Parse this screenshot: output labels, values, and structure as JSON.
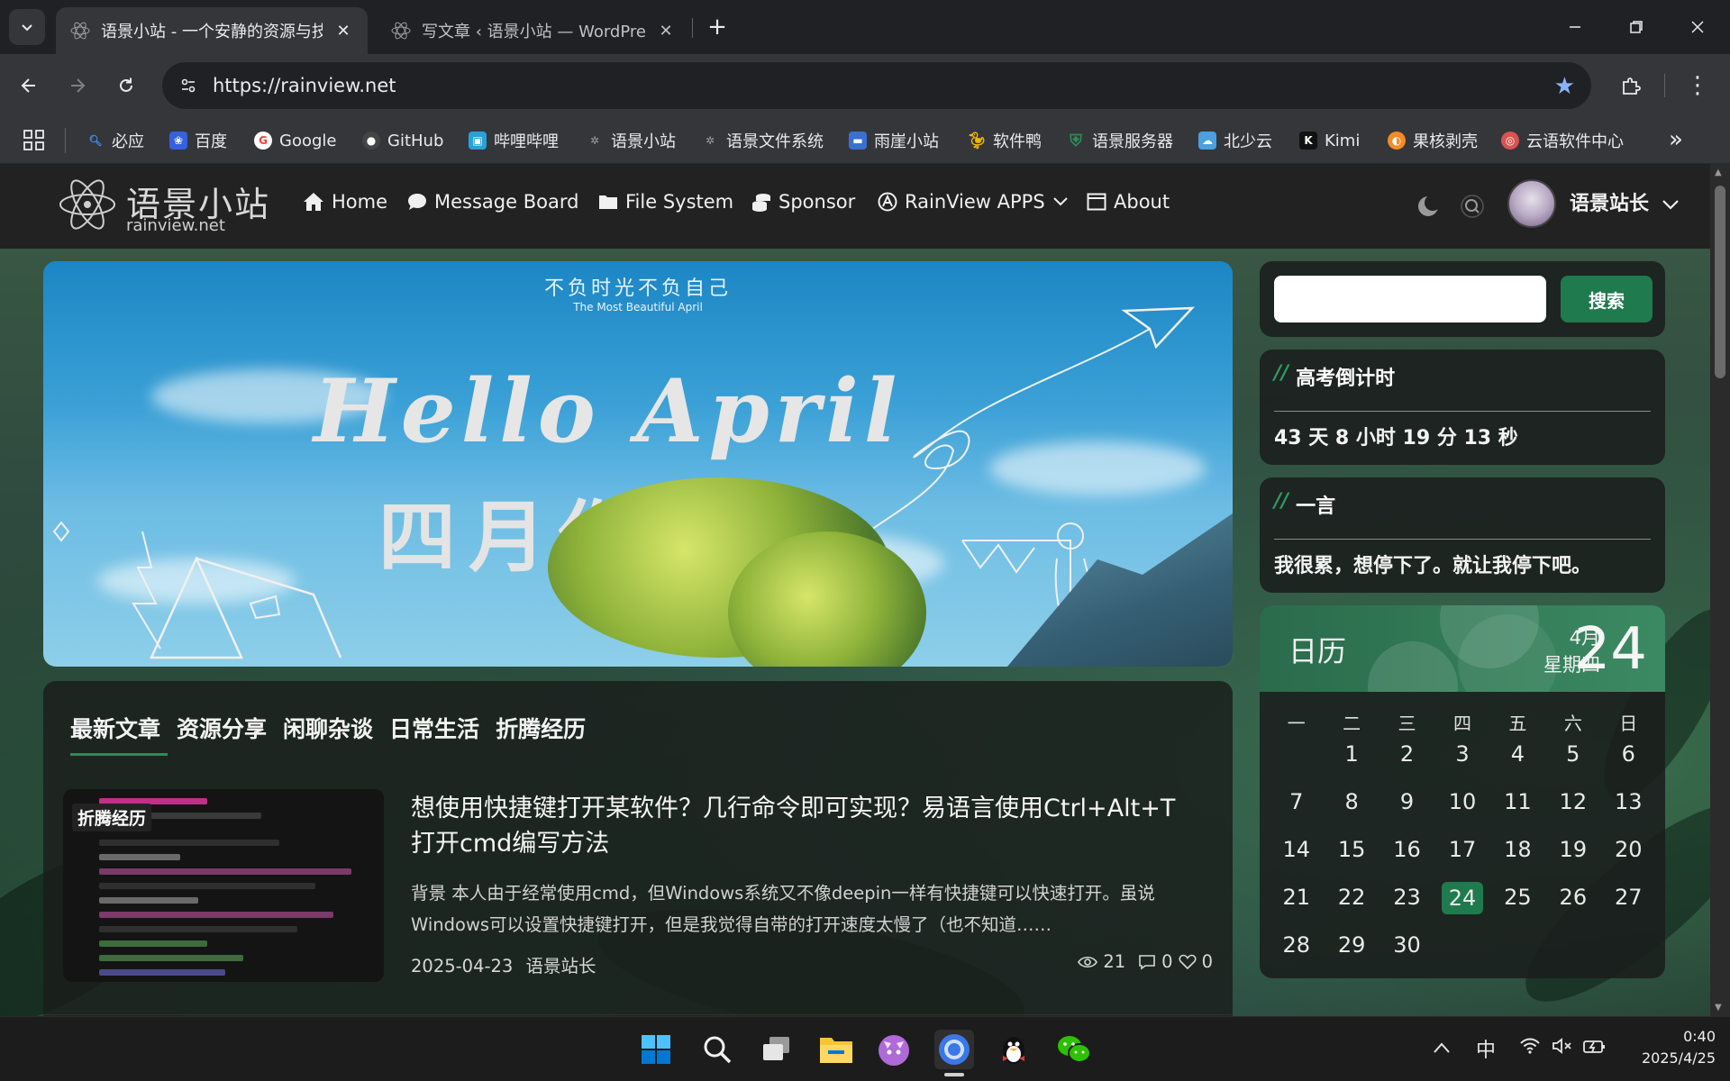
{
  "browser": {
    "tabs": [
      {
        "title": "语景小站 - 一个安静的资源与技",
        "active": true
      },
      {
        "title": "写文章 ‹ 语景小站 — WordPre",
        "active": false
      }
    ],
    "url": "https://rainview.net",
    "bookmarks": [
      {
        "label": "必应",
        "icon": "bing-icon",
        "color": "#4a8cf7"
      },
      {
        "label": "百度",
        "icon": "baidu-icon",
        "color": "#3560e0"
      },
      {
        "label": "Google",
        "icon": "google-icon",
        "color": "#ea4335"
      },
      {
        "label": "GitHub",
        "icon": "github-icon",
        "color": "#444444"
      },
      {
        "label": "哔哩哔哩",
        "icon": "bilibili-icon",
        "color": "#2aa0d8"
      },
      {
        "label": "语景小站",
        "icon": "rainview-icon",
        "color": "#8a8a9a"
      },
      {
        "label": "语景文件系统",
        "icon": "rainview-fs-icon",
        "color": "#8a8a9a"
      },
      {
        "label": "雨崖小站",
        "icon": "yuya-icon",
        "color": "#3b6fd1"
      },
      {
        "label": "软件鸭",
        "icon": "duck-icon",
        "color": "#f2b705"
      },
      {
        "label": "语景服务器",
        "icon": "shield-icon",
        "color": "#2e8b57"
      },
      {
        "label": "北少云",
        "icon": "cloud-icon",
        "color": "#4aa0e0"
      },
      {
        "label": "Kimi",
        "icon": "kimi-icon",
        "color": "#111111"
      },
      {
        "label": "果核剥壳",
        "icon": "guohe-icon",
        "color": "#f28c28"
      },
      {
        "label": "云语软件中心",
        "icon": "yunyu-icon",
        "color": "#d9534f"
      }
    ]
  },
  "site": {
    "logo_text": "语景小站",
    "logo_sub": "rainview.net",
    "nav": [
      {
        "label": "Home",
        "icon": "home-icon"
      },
      {
        "label": "Message Board",
        "icon": "chat-icon"
      },
      {
        "label": "File System",
        "icon": "folder-icon"
      },
      {
        "label": "Sponsor",
        "icon": "coins-icon"
      },
      {
        "label": "RainView APPS",
        "icon": "apps-icon"
      },
      {
        "label": "About",
        "icon": "window-icon"
      }
    ],
    "user": "语景站长"
  },
  "banner": {
    "top_cn": "不负时光不负自己",
    "top_en": "The Most Beautiful April",
    "hello": "Hello April",
    "cn": "四月你好"
  },
  "articles": {
    "categories": [
      "最新文章",
      "资源分享",
      "闲聊杂谈",
      "日常生活",
      "折腾经历"
    ],
    "post": {
      "tag": "折腾经历",
      "title": "想使用快捷键打开某软件？几行命令即可实现？易语言使用Ctrl+Alt+T打开cmd编写方法",
      "excerpt": "背景 本人由于经常使用cmd，但Windows系统又不像deepin一样有快捷键可以快速打开。虽说Windows可以设置快捷键打开，但是我觉得自带的打开速度太慢了（也不知道……",
      "date": "2025-04-23",
      "author": "语景站长",
      "views": "21",
      "comments": "0",
      "likes": "0"
    }
  },
  "sidebar": {
    "search_button": "搜索",
    "countdown_title": "高考倒计时",
    "countdown_value": "43 天 8 小时 19 分 13 秒",
    "quote_title": "一言",
    "quote_text": "我很累，想停下了。就让我停下吧。",
    "calendar": {
      "label": "日历",
      "month": "4月",
      "weekday": "星期四",
      "day": "24",
      "week_headers": [
        "一",
        "二",
        "三",
        "四",
        "五",
        "六",
        "日"
      ],
      "weeks": [
        [
          "",
          "1",
          "2",
          "3",
          "4",
          "5",
          "6"
        ],
        [
          "7",
          "8",
          "9",
          "10",
          "11",
          "12",
          "13"
        ],
        [
          "14",
          "15",
          "16",
          "17",
          "18",
          "19",
          "20"
        ],
        [
          "21",
          "22",
          "23",
          "24",
          "25",
          "26",
          "27"
        ],
        [
          "28",
          "29",
          "30",
          "",
          "",
          "",
          ""
        ]
      ],
      "today": "24"
    }
  },
  "taskbar": {
    "ime": "中",
    "time": "0:40",
    "date": "2025/4/25"
  }
}
